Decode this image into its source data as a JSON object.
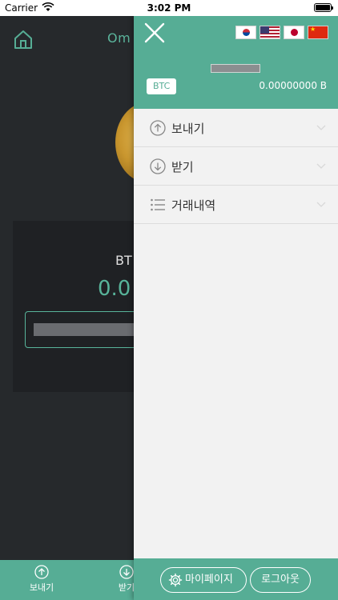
{
  "status_bar": {
    "carrier": "Carrier",
    "time": "3:02 PM"
  },
  "background": {
    "title": "Om",
    "card_label": "BT",
    "card_value": "0.0",
    "bottom_nav": [
      {
        "label": "보내기",
        "icon": "arrow-up-circle-icon"
      },
      {
        "label": "받기",
        "icon": "arrow-down-circle-icon"
      }
    ]
  },
  "drawer": {
    "languages": [
      "ko",
      "en",
      "ja",
      "zh"
    ],
    "currency": "BTC",
    "balance": "0.00000000 B",
    "menu": [
      {
        "label": "보내기",
        "icon": "arrow-up-circle-icon"
      },
      {
        "label": "받기",
        "icon": "arrow-down-circle-icon"
      },
      {
        "label": "거래내역",
        "icon": "list-icon"
      }
    ],
    "footer": {
      "mypage_label": "마이페이지",
      "logout_label": "로그아웃"
    }
  },
  "colors": {
    "accent": "#56ad95",
    "dark_bg": "#26292c",
    "drawer_bg": "#f2f2f2"
  }
}
